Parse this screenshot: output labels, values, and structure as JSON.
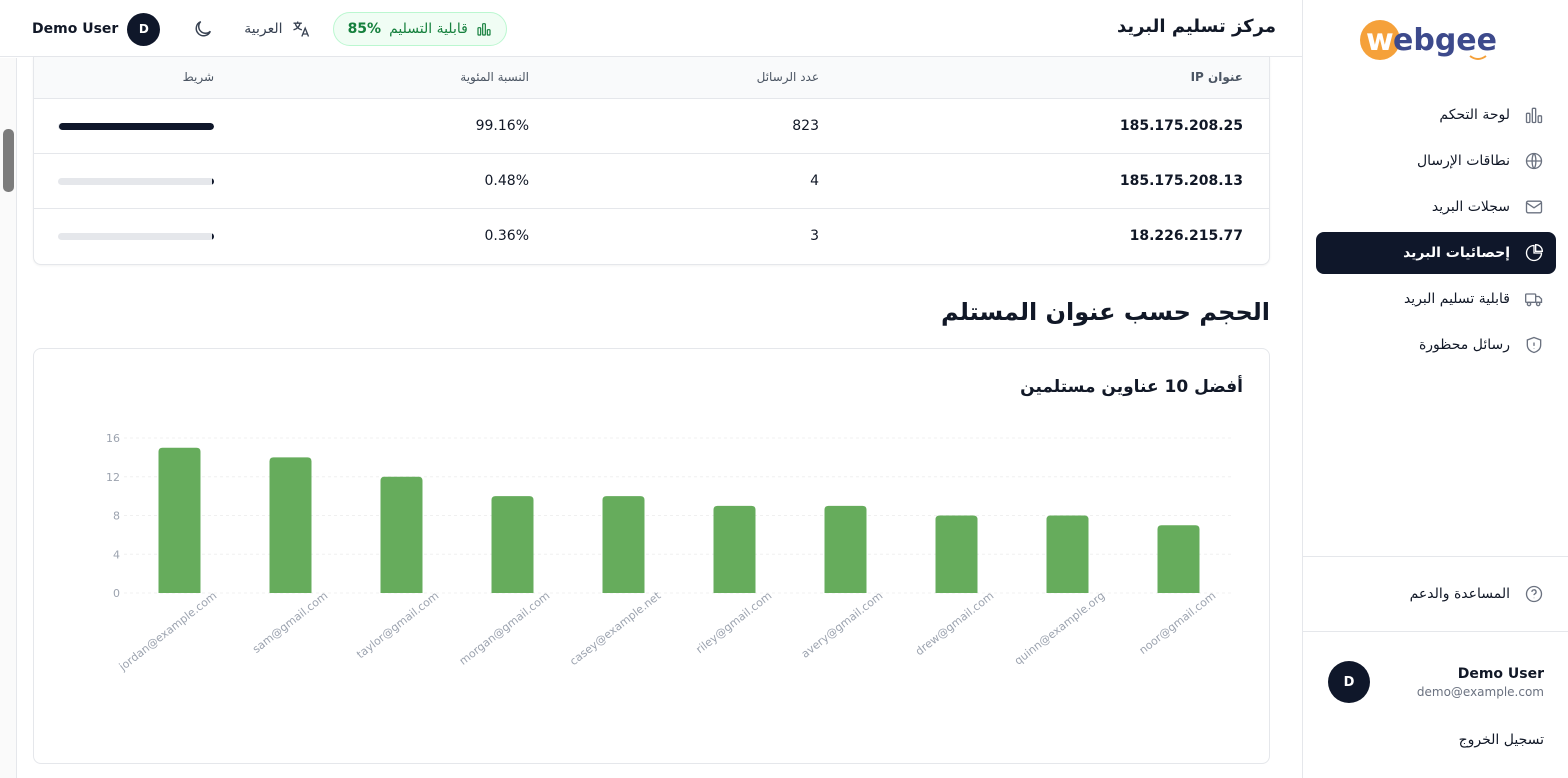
{
  "app": {
    "page_title": "مركز تسليم البريد",
    "logo_text": "webgee"
  },
  "header": {
    "user_name": "Demo User",
    "user_initial": "D",
    "language": "العربية",
    "deliverability_label": "قابلية التسليم",
    "deliverability_value": "85%"
  },
  "sidebar": {
    "items": [
      {
        "label": "لوحة التحكم",
        "icon": "bar-chart-icon",
        "active": false
      },
      {
        "label": "نطاقات الإرسال",
        "icon": "globe-icon",
        "active": false
      },
      {
        "label": "سجلات البريد",
        "icon": "mail-icon",
        "active": false
      },
      {
        "label": "إحصائيات البريد",
        "icon": "pie-chart-icon",
        "active": true
      },
      {
        "label": "قابلية تسليم البريد",
        "icon": "truck-icon",
        "active": false
      },
      {
        "label": "رسائل محظورة",
        "icon": "shield-icon",
        "active": false
      }
    ],
    "help_label": "المساعدة والدعم",
    "user_name": "Demo User",
    "user_email": "demo@example.com",
    "user_initial": "D",
    "logout_label": "تسجيل الخروج"
  },
  "ip_table": {
    "columns": [
      "عنوان IP",
      "عدد الرسائل",
      "النسبة المئوية",
      "شريط"
    ],
    "rows": [
      {
        "ip": "185.175.208.25",
        "count": "823",
        "percent": "99.16%",
        "fraction": 0.9916
      },
      {
        "ip": "185.175.208.13",
        "count": "4",
        "percent": "0.48%",
        "fraction": 0.0048
      },
      {
        "ip": "18.226.215.77",
        "count": "3",
        "percent": "0.36%",
        "fraction": 0.0036
      }
    ]
  },
  "recipient_section": {
    "title": "الحجم حسب عنوان المستلم",
    "card_title": "أفضل 10 عناوين مستلمين"
  },
  "colors": {
    "bar": "#66ac5c",
    "accent_dark": "#0f172a",
    "badge_green": "#15803d"
  },
  "chart_data": {
    "type": "bar",
    "categories": [
      "jordan@example.com",
      "sam@gmail.com",
      "taylor@gmail.com",
      "morgan@gmail.com",
      "casey@example.net",
      "riley@gmail.com",
      "avery@gmail.com",
      "drew@gmail.com",
      "quinn@example.org",
      "noor@gmail.com"
    ],
    "values": [
      15,
      14,
      12,
      10,
      10,
      9,
      9,
      8,
      8,
      7
    ],
    "yticks": [
      0,
      4,
      8,
      12,
      16
    ],
    "ylim": [
      0,
      16
    ],
    "grid": true
  }
}
